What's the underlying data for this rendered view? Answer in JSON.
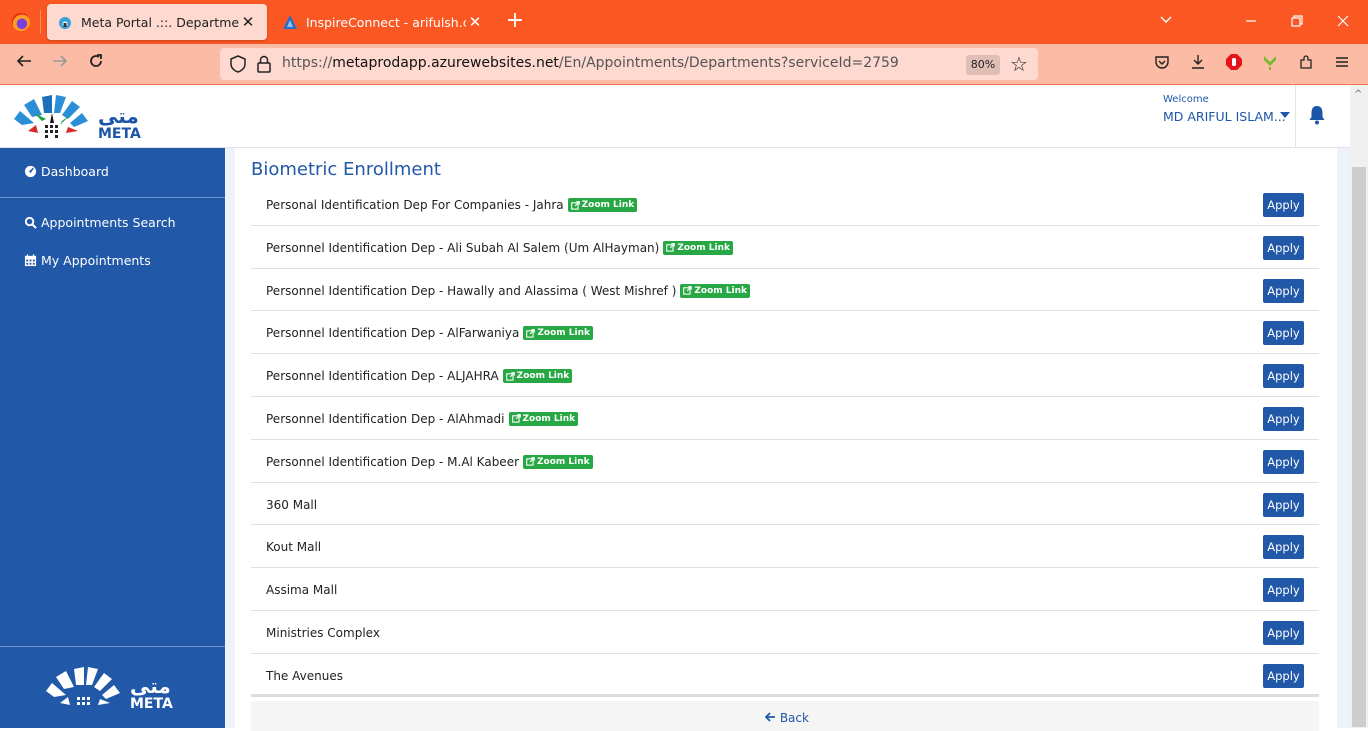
{
  "browser": {
    "tabs": [
      {
        "title": "Meta Portal .::. Departments",
        "active": true
      },
      {
        "title": "InspireConnect - arifulsh.com",
        "active": false
      }
    ],
    "url_prefix": "https://",
    "url_domain": "metaprodapp.azurewebsites.net",
    "url_path": "/En/Appointments/Departments?serviceId=2759",
    "zoom_level": "80%"
  },
  "header": {
    "logo_alt": "META",
    "welcome_label": "Welcome",
    "user_name": "MD ARIFUL ISLAM..."
  },
  "sidebar": {
    "items": [
      {
        "label": "Dashboard",
        "icon": "dashboard-icon"
      },
      {
        "label": "Appointments Search",
        "icon": "search-icon"
      },
      {
        "label": "My Appointments",
        "icon": "calendar-icon"
      }
    ]
  },
  "main": {
    "section_title": "Biometric Enrollment",
    "zoom_link_label": "Zoom Link",
    "apply_label": "Apply",
    "back_label": "Back",
    "departments": [
      {
        "name": "Personal Identification Dep For Companies - Jahra",
        "zoom_link": true
      },
      {
        "name": "Personnel Identification Dep - Ali Subah Al Salem (Um AlHayman)",
        "zoom_link": true
      },
      {
        "name": "Personnel Identification Dep - Hawally and Alassima ( West Mishref )",
        "zoom_link": true
      },
      {
        "name": "Personnel Identification Dep - AlFarwaniya",
        "zoom_link": true
      },
      {
        "name": "Personnel Identification Dep - ALJAHRA",
        "zoom_link": true
      },
      {
        "name": "Personnel Identification Dep - AlAhmadi",
        "zoom_link": true
      },
      {
        "name": "Personnel Identification Dep - M.Al Kabeer",
        "zoom_link": true
      },
      {
        "name": "360 Mall",
        "zoom_link": false
      },
      {
        "name": "Kout Mall",
        "zoom_link": false
      },
      {
        "name": "Assima Mall",
        "zoom_link": false
      },
      {
        "name": "Ministries Complex",
        "zoom_link": false
      },
      {
        "name": "The Avenues",
        "zoom_link": false
      }
    ]
  },
  "colors": {
    "primary": "#2158a8",
    "zoom_link_green": "#27a844",
    "browser_accent": "#fa5722"
  }
}
